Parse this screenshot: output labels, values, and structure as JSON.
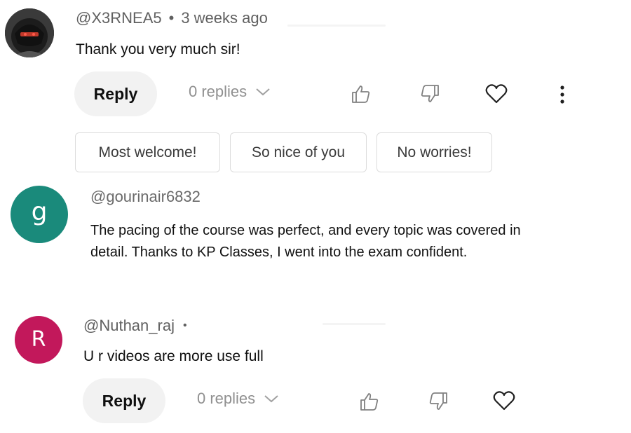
{
  "comments": [
    {
      "handle": "@X3RNEA5",
      "separator": "•",
      "time": "3 weeks ago",
      "text": "Thank you very much sir!",
      "reply_label": "Reply",
      "replies_label": "0 replies",
      "suggestions": [
        "Most welcome!",
        "So nice of you",
        "No worries!"
      ]
    },
    {
      "handle": "@gourinair6832",
      "avatar_letter": "g",
      "avatar_color": "#1a8a7b",
      "text": "The pacing of the course was perfect, and every topic was covered in detail. Thanks to KP Classes, I went into the exam confident."
    },
    {
      "handle": "@Nuthan_raj",
      "separator": "•",
      "avatar_letter": "R",
      "avatar_color": "#c2185b",
      "text": "U r  videos are more use full",
      "reply_label": "Reply",
      "replies_label": "0 replies"
    }
  ],
  "icons": [
    "thumbs-up-icon",
    "thumbs-down-icon",
    "heart-icon",
    "more-vert-icon",
    "chevron-down-icon"
  ]
}
